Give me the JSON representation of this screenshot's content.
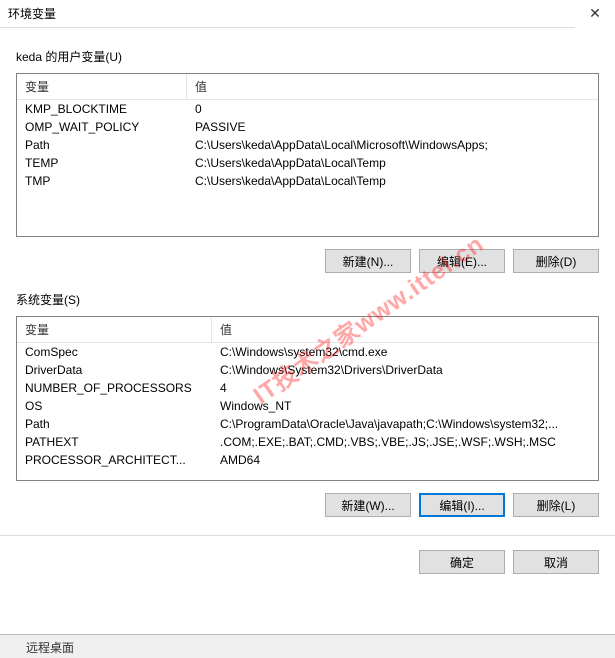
{
  "window": {
    "title": "环境变量",
    "close_icon": "✕"
  },
  "user_section": {
    "label": "keda 的用户变量(U)",
    "col_name": "变量",
    "col_value": "值",
    "rows": [
      {
        "name": "KMP_BLOCKTIME",
        "value": "0"
      },
      {
        "name": "OMP_WAIT_POLICY",
        "value": "PASSIVE"
      },
      {
        "name": "Path",
        "value": "C:\\Users\\keda\\AppData\\Local\\Microsoft\\WindowsApps;"
      },
      {
        "name": "TEMP",
        "value": "C:\\Users\\keda\\AppData\\Local\\Temp"
      },
      {
        "name": "TMP",
        "value": "C:\\Users\\keda\\AppData\\Local\\Temp"
      }
    ],
    "btn_new": "新建(N)...",
    "btn_edit": "编辑(E)...",
    "btn_delete": "删除(D)"
  },
  "system_section": {
    "label": "系统变量(S)",
    "col_name": "变量",
    "col_value": "值",
    "rows": [
      {
        "name": "ComSpec",
        "value": "C:\\Windows\\system32\\cmd.exe"
      },
      {
        "name": "DriverData",
        "value": "C:\\Windows\\System32\\Drivers\\DriverData"
      },
      {
        "name": "NUMBER_OF_PROCESSORS",
        "value": "4"
      },
      {
        "name": "OS",
        "value": "Windows_NT"
      },
      {
        "name": "Path",
        "value": "C:\\ProgramData\\Oracle\\Java\\javapath;C:\\Windows\\system32;..."
      },
      {
        "name": "PATHEXT",
        "value": ".COM;.EXE;.BAT;.CMD;.VBS;.VBE;.JS;.JSE;.WSF;.WSH;.MSC"
      },
      {
        "name": "PROCESSOR_ARCHITECT...",
        "value": "AMD64"
      }
    ],
    "btn_new": "新建(W)...",
    "btn_edit": "编辑(I)...",
    "btn_delete": "删除(L)"
  },
  "dialog_buttons": {
    "ok": "确定",
    "cancel": "取消"
  },
  "watermark": "IT技术之家www.ittel.cn",
  "parent_fragment": "远程桌面"
}
